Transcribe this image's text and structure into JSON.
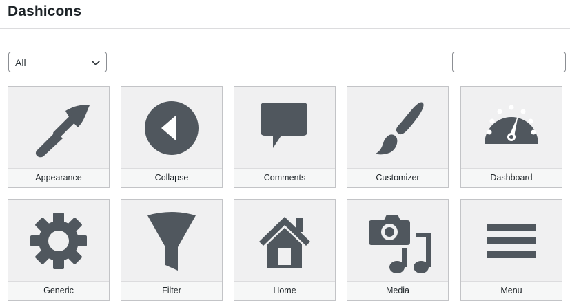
{
  "page": {
    "title": "Dashicons"
  },
  "filter": {
    "selected": "All",
    "search_value": ""
  },
  "icons": [
    {
      "label": "Appearance",
      "icon": "appearance-brush-icon"
    },
    {
      "label": "Collapse",
      "icon": "collapse-icon"
    },
    {
      "label": "Comments",
      "icon": "comments-icon"
    },
    {
      "label": "Customizer",
      "icon": "customizer-brush-icon"
    },
    {
      "label": "Dashboard",
      "icon": "dashboard-gauge-icon"
    },
    {
      "label": "Generic",
      "icon": "gear-icon"
    },
    {
      "label": "Filter",
      "icon": "filter-funnel-icon"
    },
    {
      "label": "Home",
      "icon": "home-icon"
    },
    {
      "label": "Media",
      "icon": "media-icon"
    },
    {
      "label": "Menu",
      "icon": "menu-icon"
    }
  ],
  "colors": {
    "icon": "#50575e",
    "card_bg": "#f0f0f1",
    "card_border": "#c3c4c7"
  }
}
